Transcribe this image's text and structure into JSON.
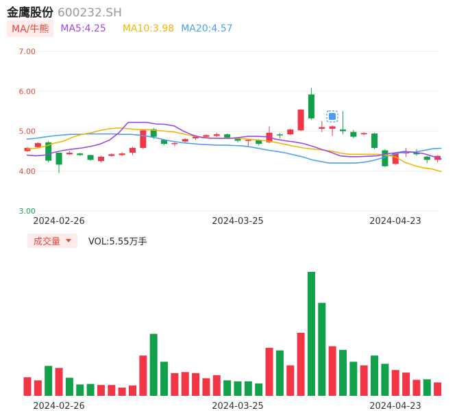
{
  "header": {
    "name": "金鹰股份",
    "code": "600232.SH"
  },
  "legend": {
    "ma_selector": "MA/牛熊",
    "ma5": "MA5:4.25",
    "ma10": "MA10:3.98",
    "ma20": "MA20:4.57"
  },
  "volume_legend": {
    "selector": "成交量",
    "value": "VOL:5.55万手"
  },
  "colors": {
    "up": "#f23645",
    "down": "#12a14a",
    "ma5": "#9b46e6",
    "ma10": "#f5b400",
    "ma20": "#4a9ff5",
    "grid": "#eeeeee"
  },
  "chart_data": [
    {
      "type": "candlestick",
      "ylim": [
        3.0,
        7.0
      ],
      "yticks": [
        "7.00",
        "6.00",
        "5.00",
        "4.00",
        "3.00"
      ],
      "xtick_labels": [
        {
          "index": 2,
          "label": "2024-02-26"
        },
        {
          "index": 19,
          "label": "2024-03-25"
        },
        {
          "index": 34,
          "label": "2024-04-23"
        }
      ],
      "ohlc": [
        [
          4.5,
          4.58,
          4.48,
          4.6
        ],
        [
          4.6,
          4.7,
          4.58,
          4.72
        ],
        [
          4.72,
          4.26,
          4.22,
          4.75
        ],
        [
          4.46,
          4.16,
          3.95,
          4.46
        ],
        [
          4.42,
          4.46,
          4.4,
          4.5
        ],
        [
          4.44,
          4.4,
          4.38,
          4.46
        ],
        [
          4.4,
          4.28,
          4.26,
          4.41
        ],
        [
          4.25,
          4.36,
          4.21,
          4.38
        ],
        [
          4.38,
          4.42,
          4.36,
          4.44
        ],
        [
          4.4,
          4.44,
          4.38,
          4.47
        ],
        [
          4.46,
          4.58,
          4.4,
          4.6
        ],
        [
          4.58,
          5.02,
          4.55,
          5.05
        ],
        [
          5.05,
          4.86,
          4.8,
          5.08
        ],
        [
          4.78,
          4.68,
          4.65,
          4.8
        ],
        [
          4.68,
          4.7,
          4.62,
          4.72
        ],
        [
          4.74,
          4.8,
          4.72,
          4.82
        ],
        [
          4.82,
          4.86,
          4.78,
          4.88
        ],
        [
          4.86,
          4.9,
          4.84,
          4.92
        ],
        [
          4.88,
          4.92,
          4.85,
          4.96
        ],
        [
          4.92,
          4.84,
          4.8,
          4.94
        ],
        [
          4.82,
          4.76,
          4.72,
          4.84
        ],
        [
          4.76,
          4.78,
          4.62,
          4.8
        ],
        [
          4.78,
          4.68,
          4.64,
          4.8
        ],
        [
          4.72,
          4.96,
          4.7,
          5.12
        ],
        [
          4.92,
          4.9,
          4.82,
          4.95
        ],
        [
          4.92,
          5.04,
          4.9,
          5.06
        ],
        [
          5.02,
          5.54,
          5.0,
          5.55
        ],
        [
          5.92,
          5.32,
          5.28,
          6.08
        ],
        [
          5.06,
          5.1,
          4.98,
          5.25
        ],
        [
          5.06,
          5.12,
          4.88,
          5.14
        ],
        [
          5.04,
          5.0,
          4.92,
          5.5
        ],
        [
          4.98,
          4.86,
          4.82,
          5.03
        ],
        [
          4.92,
          4.95,
          4.9,
          4.97
        ],
        [
          4.94,
          4.58,
          4.55,
          4.96
        ],
        [
          4.52,
          4.12,
          4.1,
          4.55
        ],
        [
          4.18,
          4.46,
          4.15,
          4.47
        ],
        [
          4.44,
          4.48,
          4.35,
          4.58
        ],
        [
          4.46,
          4.42,
          4.38,
          4.55
        ],
        [
          4.36,
          4.28,
          4.2,
          4.38
        ],
        [
          4.28,
          4.38,
          4.22,
          4.4
        ]
      ],
      "ma5": [
        4.4,
        4.38,
        4.4,
        4.47,
        4.52,
        4.55,
        4.58,
        4.62,
        4.68,
        4.78,
        4.96,
        5.22,
        5.22,
        5.22,
        5.18,
        5.17,
        5.13,
        5.0,
        4.9,
        4.84,
        4.82,
        4.82,
        4.82,
        4.84,
        4.87,
        4.87,
        4.86,
        4.8,
        4.76,
        4.73,
        4.69,
        4.62,
        4.54,
        4.47,
        4.38,
        4.36,
        4.36,
        4.37,
        4.38,
        4.43,
        4.46,
        4.49,
        4.47,
        4.44,
        4.37,
        4.3
      ],
      "ma10": [
        4.55,
        4.57,
        4.62,
        4.7,
        4.75,
        4.85,
        4.92,
        4.96,
        5.02,
        5.06,
        5.08,
        5.06,
        5.04,
        5.04,
        5.02,
        5.0,
        4.98,
        4.93,
        4.88,
        4.85,
        4.83,
        4.82,
        4.82,
        4.82,
        4.8,
        4.78,
        4.76,
        4.72,
        4.67,
        4.62,
        4.58,
        4.55,
        4.53,
        4.5,
        4.45,
        4.42,
        4.42,
        4.42,
        4.42,
        4.4,
        4.35,
        4.22,
        4.14,
        4.08,
        4.05,
        3.98
      ],
      "ma20": [
        4.8,
        4.82,
        4.85,
        4.88,
        4.9,
        4.92,
        4.92,
        4.93,
        4.93,
        4.93,
        4.93,
        4.92,
        4.92,
        4.9,
        4.87,
        4.83,
        4.78,
        4.74,
        4.71,
        4.69,
        4.67,
        4.66,
        4.65,
        4.65,
        4.64,
        4.63,
        4.6,
        4.56,
        4.52,
        4.49,
        4.45,
        4.4,
        4.35,
        4.28,
        4.24,
        4.2,
        4.2,
        4.2,
        4.2,
        4.22,
        4.26,
        4.32,
        4.39,
        4.45,
        4.47,
        4.48,
        4.52,
        4.56,
        4.57
      ]
    },
    {
      "type": "bar",
      "name": "VOL",
      "values": [
        1.8,
        1.5,
        2.9,
        2.7,
        1.75,
        1.1,
        1.15,
        1.05,
        1.05,
        0.8,
        1.0,
        3.9,
        6.0,
        3.3,
        2.2,
        2.3,
        2.2,
        1.7,
        2.0,
        1.5,
        1.4,
        1.4,
        1.2,
        4.65,
        4.4,
        2.95,
        6.1,
        12.0,
        9.0,
        4.8,
        4.45,
        3.3,
        2.95,
        3.9,
        3.1,
        2.5,
        2.25,
        1.55,
        1.6,
        1.3
      ],
      "up": [
        true,
        true,
        false,
        true,
        false,
        false,
        false,
        true,
        true,
        true,
        true,
        true,
        false,
        false,
        true,
        true,
        true,
        true,
        true,
        false,
        false,
        false,
        false,
        true,
        false,
        true,
        true,
        false,
        false,
        true,
        false,
        false,
        true,
        false,
        false,
        true,
        true,
        true,
        false,
        true
      ],
      "ylim": [
        0,
        12.0
      ]
    }
  ]
}
